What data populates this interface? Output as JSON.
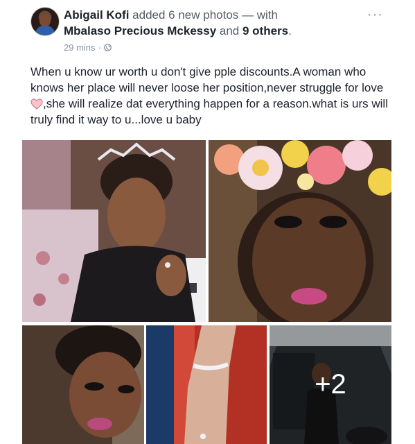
{
  "post": {
    "author": "Abigail Kofi",
    "action": " added 6 new photos — with",
    "tagged_name": "Mbalaso Precious Mckessy",
    "and_text": " and ",
    "others": "9 others",
    "period": ".",
    "time": "29 mins",
    "dot": "·",
    "text_part1": "When u know ur worth u don't give pple discounts.A woman who knows her place will never loose her position,never struggle for love ",
    "text_part2": ",she will realize dat everything happen for a reason.what is urs will truly  find it way to u...love u baby",
    "more_label": "···",
    "extra_photos_label": "+2"
  },
  "icons": {
    "avatar": "avatar",
    "privacy": "globe-icon",
    "more": "more-options-icon",
    "heart": "heart-emoji"
  },
  "colors": {
    "name_text": "#1d2129",
    "meta_text": "#8c939d",
    "heart": "#f28b9a"
  }
}
